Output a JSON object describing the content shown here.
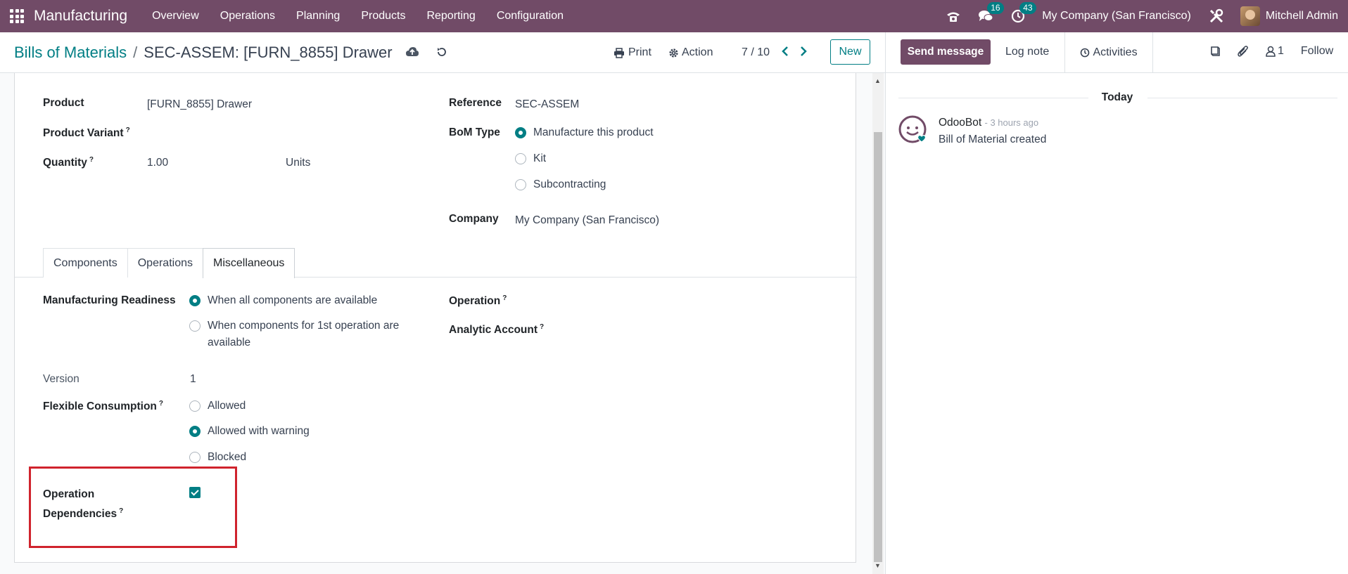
{
  "navbar": {
    "app_name": "Manufacturing",
    "menu": [
      "Overview",
      "Operations",
      "Planning",
      "Products",
      "Reporting",
      "Configuration"
    ],
    "messages_count": "16",
    "activities_count": "43",
    "company": "My Company (San Francisco)",
    "user": "Mitchell Admin"
  },
  "control": {
    "breadcrumb_parent": "Bills of Materials",
    "breadcrumb_sep": "/",
    "breadcrumb_current": "SEC-ASSEM: [FURN_8855] Drawer",
    "print_label": "Print",
    "action_label": "Action",
    "pager": "7 / 10",
    "new_label": "New"
  },
  "form": {
    "product_label": "Product",
    "product_value": "[FURN_8855] Drawer",
    "variant_label": "Product Variant",
    "quantity_label": "Quantity",
    "quantity_value": "1.00",
    "uom_value": "Units",
    "reference_label": "Reference",
    "reference_value": "SEC-ASSEM",
    "bom_type_label": "BoM Type",
    "bom_types": [
      "Manufacture this product",
      "Kit",
      "Subcontracting"
    ],
    "company_label": "Company",
    "company_value": "My Company (San Francisco)",
    "question_mark": "?"
  },
  "tabs": [
    "Components",
    "Operations",
    "Miscellaneous"
  ],
  "misc": {
    "readiness_label": "Manufacturing Readiness",
    "readiness_opt1": "When all components are available",
    "readiness_opt2_line1": "When components for 1st operation are",
    "readiness_opt2_line2": "available",
    "version_label": "Version",
    "version_value": "1",
    "flexible_label": "Flexible Consumption",
    "flexible_options": [
      "Allowed",
      "Allowed with warning",
      "Blocked"
    ],
    "dependencies_label_line1": "Operation",
    "dependencies_label_line2": "Dependencies",
    "operation_label": "Operation",
    "analytic_label": "Analytic Account"
  },
  "chatter": {
    "send_label": "Send message",
    "log_label": "Log note",
    "activities_label": "Activities",
    "followers_count": "1",
    "follow_label": "Follow",
    "today_label": "Today",
    "author": "OdooBot",
    "time": "- 3 hours ago",
    "body": "Bill of Material created"
  },
  "colors": {
    "brand": "#714b67",
    "accent": "#017e84",
    "highlight": "#d0232d"
  }
}
